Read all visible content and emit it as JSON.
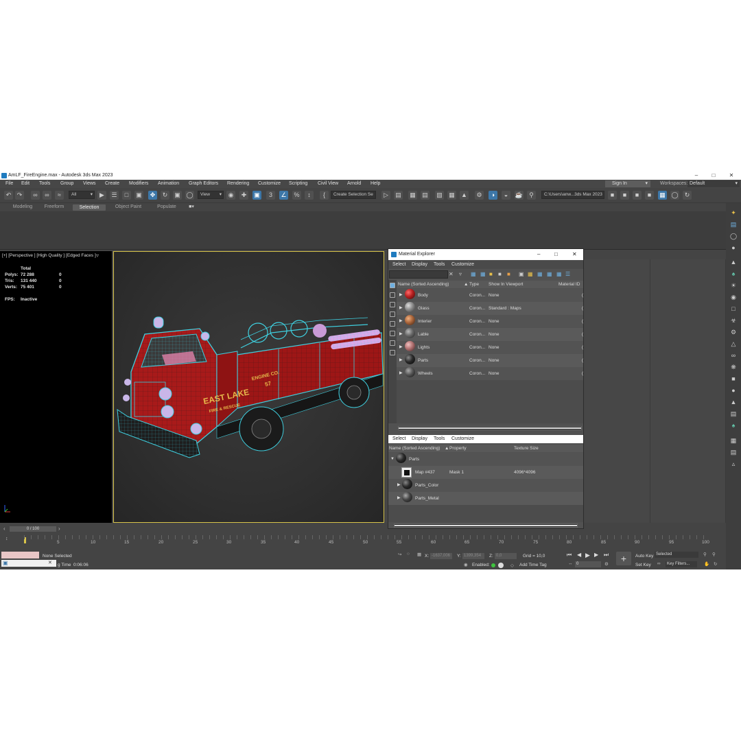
{
  "window": {
    "title": "AmLF_FireEngine.max - Autodesk 3ds Max 2023"
  },
  "menu": [
    "File",
    "Edit",
    "Tools",
    "Group",
    "Views",
    "Create",
    "Modifiers",
    "Animation",
    "Graph Editors",
    "Rendering",
    "Customize",
    "Scripting",
    "Civil View",
    "Arnold",
    "Help"
  ],
  "account": {
    "sign_in": "Sign In",
    "workspaces_label": "Workspaces:",
    "workspace_value": "Default"
  },
  "toolbar": {
    "filter_value": "All",
    "view_value": "View",
    "selection_set": "Create Selection Se",
    "project_path": "C:\\Users\\anw...3ds Max 2023"
  },
  "ribbon_tabs": [
    "Modeling",
    "Freeform",
    "Selection",
    "Object Paint",
    "Populate"
  ],
  "ribbon_active": "Selection",
  "viewport": {
    "label": "[+] [Perspective ] [High Quality ] [Edged Faces ]"
  },
  "stats": {
    "total_label": "Total",
    "rows": [
      {
        "k": "Polys:",
        "v": "72 288",
        "s": "0"
      },
      {
        "k": "Tris:",
        "v": "131 440",
        "s": "0"
      },
      {
        "k": "Verts:",
        "v": "75 401",
        "s": "0"
      }
    ],
    "fps_label": "FPS:",
    "fps_value": "Inactive"
  },
  "truck_text": {
    "brand": "EAST LAKE",
    "sub": "FIRE & RESCUE",
    "engine": "ENGINE CO.",
    "number": "57"
  },
  "timeline": {
    "frame": "0 / 100",
    "ticks": [
      "5",
      "10",
      "15",
      "20",
      "25",
      "30",
      "35",
      "40",
      "45",
      "50",
      "55",
      "60",
      "65",
      "70",
      "75",
      "80",
      "85",
      "90",
      "95",
      "100"
    ]
  },
  "status": {
    "selection": "None Selected",
    "x_label": "X:",
    "x_value": "-1637,006",
    "y_label": "Y:",
    "y_value": "1399,354",
    "z_label": "Z:",
    "z_value": "0,0",
    "grid": "Grid = 10,0",
    "enabled": "Enabled:",
    "add_time_tag": "Add Time Tag",
    "time_prefix": "g Time",
    "time": "0:06:06",
    "auto_key": "Auto Key",
    "set_key": "Set Key",
    "key_mode": "Selected",
    "key_filters": "Key Filters...",
    "current_frame": "0"
  },
  "material_explorer": {
    "title": "Material Explorer",
    "menu": [
      "Select",
      "Display",
      "Tools",
      "Customize"
    ],
    "columns": [
      "Name (Sorted Ascending)",
      "Type",
      "Show In Viewport",
      "Material ID"
    ],
    "rows": [
      {
        "name": "Body",
        "type": "Coron...",
        "viewport": "None",
        "color": "#b52020"
      },
      {
        "name": "Glass",
        "type": "Coron...",
        "viewport": "Standard : Maps",
        "color": "#8a8a8a"
      },
      {
        "name": "Interier",
        "type": "Coron...",
        "viewport": "None",
        "color": "#a8643a"
      },
      {
        "name": "Lable",
        "type": "Coron...",
        "viewport": "None",
        "color": "#666666"
      },
      {
        "name": "Lights",
        "type": "Coron...",
        "viewport": "None",
        "color": "#b07070"
      },
      {
        "name": "Parts",
        "type": "Coron...",
        "viewport": "None",
        "color": "#2a2a2a"
      },
      {
        "name": "Wheels",
        "type": "Coron...",
        "viewport": "None",
        "color": "#555555"
      }
    ],
    "lower_menu": [
      "Select",
      "Display",
      "Tools",
      "Customize"
    ],
    "lower_columns": [
      "Name (Sorted Ascending)",
      "Property",
      "Texture Size"
    ],
    "lower_rows": [
      {
        "name": "Parts",
        "property": "",
        "size": ""
      },
      {
        "name": "Map #437",
        "property": "Mask 1",
        "size": "4096*4096"
      },
      {
        "name": "Parts_Color",
        "property": "",
        "size": ""
      },
      {
        "name": "Parts_Metal",
        "property": "",
        "size": ""
      }
    ]
  },
  "colors": {
    "accent": "#3d77a8",
    "wire": "#3fd0e0",
    "body_red": "#b01818",
    "active_frame": "#d8c44a"
  }
}
